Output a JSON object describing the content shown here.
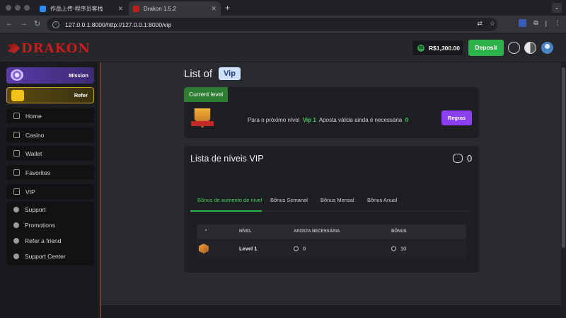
{
  "browser": {
    "tabs": [
      {
        "title": "作品上传-程序员客栈",
        "favicon_color": "#2d8cf0"
      },
      {
        "title": "Drakon 1.5.2",
        "favicon_color": "#c51d1d"
      }
    ],
    "url": "127.0.0.1:8000/http://127.0.0.1:8000/vip"
  },
  "header": {
    "logo": "DRAKON",
    "balance": "R$1,300.00",
    "balance_currency_badge": "R$",
    "deposit_label": "Deposit"
  },
  "sidebar": {
    "mission_label": "Mission",
    "refer_label": "Refer",
    "items": [
      "Home",
      "Casino",
      "Wallet",
      "Favorites",
      "VIP"
    ],
    "group_items": [
      "Support",
      "Promotions",
      "Refer a friend",
      "Support Center"
    ]
  },
  "page": {
    "title": "List of",
    "title_chip": "Vip"
  },
  "current_level": {
    "tab_label": "Current level",
    "text_prefix": "Para o próximo nível",
    "next_level": "Vip 1",
    "text_middle": "Aposta válida ainda é necessária",
    "remaining": "0",
    "rules_button": "Regras"
  },
  "vip_list": {
    "title": "Lista de níveis VIP",
    "count": "0",
    "tabs": [
      "Bônus de aumento de nível",
      "Bônus Semanal",
      "Bônus Mensal",
      "Bônus Anual"
    ],
    "columns": [
      "*",
      "NÍVEL",
      "APOSTA NECESSÁRIA",
      "BÔNUS"
    ],
    "rows": [
      {
        "level": "Level 1",
        "bet": "0",
        "bonus": "10"
      }
    ]
  },
  "colors": {
    "accent_green": "#2db34a",
    "rules_purple": "#8a3ff0",
    "logo_red": "#c51d1d"
  }
}
